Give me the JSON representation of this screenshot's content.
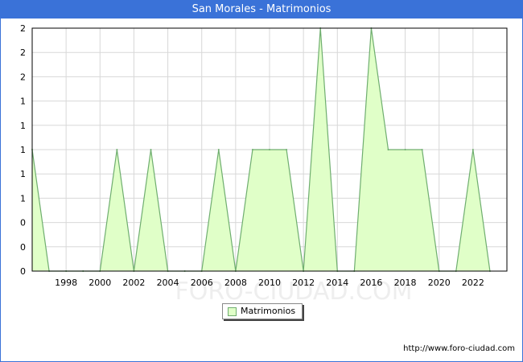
{
  "header": {
    "title": "San Morales - Matrimonios"
  },
  "footer": {
    "url": "http://www.foro-ciudad.com"
  },
  "watermark": "FORO-CIUDAD.COM",
  "colors": {
    "title_bar": "#3a72d8",
    "area_fill": "#e0ffc8",
    "area_stroke": "#6fae6f",
    "grid": "#d8d8d8"
  },
  "chart_data": {
    "type": "area",
    "title": "San Morales - Matrimonios",
    "xlabel": "",
    "ylabel": "",
    "series": [
      {
        "name": "Matrimonios",
        "x": [
          1996,
          1997,
          1998,
          1999,
          2000,
          2001,
          2002,
          2003,
          2004,
          2005,
          2006,
          2007,
          2008,
          2009,
          2010,
          2011,
          2012,
          2013,
          2014,
          2015,
          2016,
          2017,
          2018,
          2019,
          2020,
          2021,
          2022,
          2023
        ],
        "values": [
          1,
          0,
          0,
          0,
          0,
          1,
          0,
          1,
          0,
          0,
          0,
          1,
          0,
          1,
          1,
          1,
          0,
          2,
          0,
          0,
          2,
          1,
          1,
          1,
          0,
          0,
          1,
          0
        ]
      }
    ],
    "xlim": [
      1996,
      2024
    ],
    "ylim": [
      0,
      2
    ],
    "x_ticks": [
      1998,
      2000,
      2002,
      2004,
      2006,
      2008,
      2010,
      2012,
      2014,
      2016,
      2018,
      2020,
      2022
    ],
    "y_tick_labels": [
      "0",
      "0",
      "0",
      "1",
      "1",
      "1",
      "1",
      "1",
      "2",
      "2",
      "2"
    ],
    "grid": true,
    "legend": "bottom-center"
  }
}
